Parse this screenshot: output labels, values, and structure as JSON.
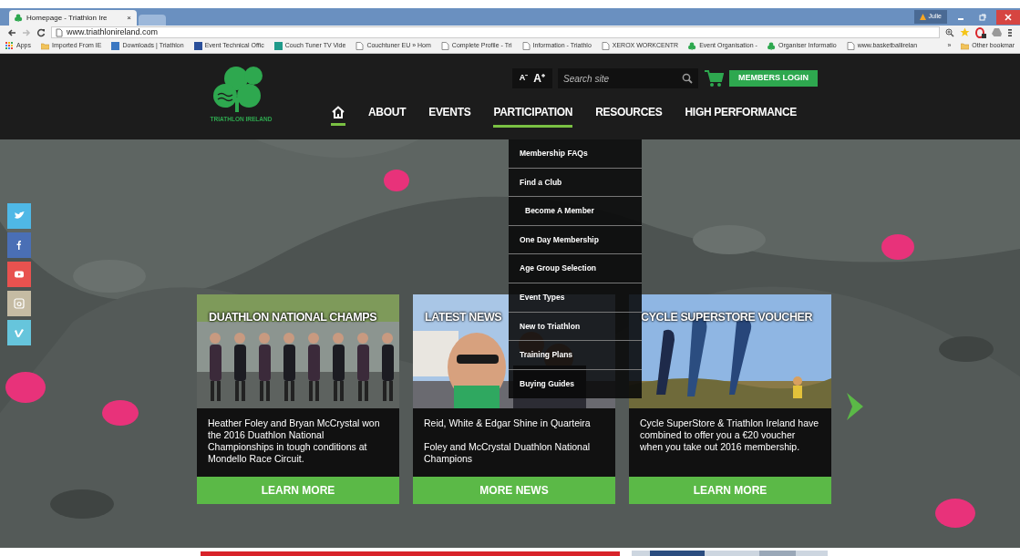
{
  "browser": {
    "tabs": [
      {
        "title": "Homepage - Triathlon Ire",
        "close": "×",
        "selected": true
      },
      {
        "selected": false
      }
    ],
    "profile": "Julie",
    "address": "www.triathlonireland.com",
    "bookmarks": [
      {
        "kind": "apps",
        "label": "Apps"
      },
      {
        "kind": "folder",
        "label": "Imported From IE"
      },
      {
        "kind": "favicon",
        "color": "#3b78c2",
        "label": "Downloads | Triathlon"
      },
      {
        "kind": "favicon",
        "color": "#2a4f9a",
        "label": "Event Technical Offic"
      },
      {
        "kind": "favicon",
        "color": "#1f9a8a",
        "label": "Couch Tuner TV Vide"
      },
      {
        "kind": "page",
        "label": "Couchtuner EU » Hom"
      },
      {
        "kind": "page",
        "label": "Complete Profile - Tri"
      },
      {
        "kind": "page",
        "label": "Information - Triathlo"
      },
      {
        "kind": "page",
        "label": "XEROX WORKCENTR"
      },
      {
        "kind": "shamrock",
        "label": "Event Organisation -"
      },
      {
        "kind": "shamrock",
        "label": "Organiser Informatio"
      },
      {
        "kind": "page",
        "label": "www.basketballirelan"
      }
    ],
    "overflow": "»",
    "other_bookmarks": "Other bookmar"
  },
  "header": {
    "logo_text": "TRIATHLON IRELAND",
    "font_buttons": [
      "A⁻",
      "A⁺"
    ],
    "search": {
      "placeholder": "Search site"
    },
    "login_button": "MEMBERS LOGIN",
    "nav": [
      {
        "kind": "home",
        "underlined": true
      },
      {
        "kind": "text",
        "label": "ABOUT",
        "underlined": false
      },
      {
        "kind": "text",
        "label": "EVENTS",
        "underlined": false
      },
      {
        "kind": "text",
        "label": "PARTICIPATION",
        "underlined": true
      },
      {
        "kind": "text",
        "label": "RESOURCES",
        "underlined": false
      },
      {
        "kind": "text",
        "label": "HIGH PERFORMANCE",
        "underlined": false
      }
    ]
  },
  "dropdown": [
    {
      "label": "Membership FAQs",
      "indented": false
    },
    {
      "label": "Find a Club",
      "indented": false
    },
    {
      "label": "Become A Member",
      "indented": true
    },
    {
      "label": "One Day Membership",
      "indented": false
    },
    {
      "label": "Age Group Selection",
      "indented": false
    },
    {
      "label": "Event Types",
      "indented": false
    },
    {
      "label": "New to Triathlon",
      "indented": false
    },
    {
      "label": "Training Plans",
      "indented": false
    },
    {
      "label": "Buying Guides",
      "indented": false
    }
  ],
  "social": [
    {
      "kind": "twitter",
      "color": "#4fb8e6"
    },
    {
      "kind": "facebook",
      "color": "#4a6fb5"
    },
    {
      "kind": "youtube",
      "color": "#e8524f"
    },
    {
      "kind": "instagram",
      "color": "#c5bba3"
    },
    {
      "kind": "vimeo",
      "color": "#66c5dc"
    }
  ],
  "cards": [
    {
      "title": "DUATHLON NATIONAL CHAMPS",
      "paragraphs": [
        "Heather Foley and Bryan McCrystal won the 2016 Duathlon National Championships in tough conditions at Mondello Race Circuit."
      ],
      "button": "LEARN MORE"
    },
    {
      "title": "LATEST NEWS",
      "paragraphs": [
        "Reid, White & Edgar Shine in Quarteira",
        "Foley and McCrystal Duathlon National Champions"
      ],
      "button": "MORE NEWS"
    },
    {
      "title": "CYCLE SUPERSTORE VOUCHER",
      "paragraphs": [
        "Cycle SuperStore & Triathlon Ireland have combined to offer you a €20 voucher when you take out 2016 membership."
      ],
      "button": "LEARN MORE"
    }
  ]
}
